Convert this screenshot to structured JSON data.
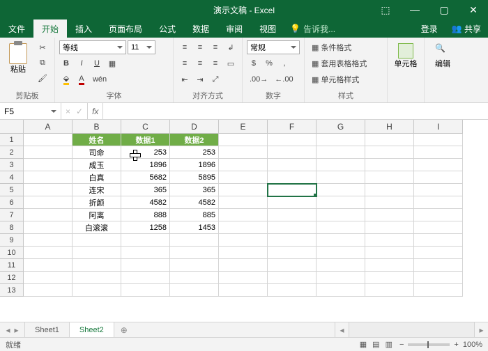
{
  "app": {
    "title": "演示文稿 - Excel"
  },
  "window_icons": {
    "popout": "⬚",
    "min": "—",
    "max": "▢",
    "close": "✕"
  },
  "tabs": {
    "file": "文件",
    "home": "开始",
    "insert": "插入",
    "layout": "页面布局",
    "formula": "公式",
    "data": "数据",
    "review": "审阅",
    "view": "视图",
    "tell": "告诉我...",
    "signin": "登录",
    "share": "共享"
  },
  "ribbon": {
    "clipboard": {
      "label": "剪贴板",
      "paste": "粘贴"
    },
    "font": {
      "label": "字体",
      "name": "等线",
      "size": "11",
      "bold": "B",
      "italic": "I",
      "underline": "U"
    },
    "align": {
      "label": "对齐方式"
    },
    "number": {
      "label": "数字",
      "format": "常规"
    },
    "styles": {
      "label": "样式",
      "cond": "条件格式",
      "table": "套用表格格式",
      "cell": "单元格样式"
    },
    "cells": {
      "label": "单元格"
    },
    "editing": {
      "label": "编辑"
    }
  },
  "namebox": "F5",
  "formula": "",
  "cols": [
    "A",
    "B",
    "C",
    "D",
    "E",
    "F",
    "G",
    "H",
    "I"
  ],
  "rows": 13,
  "header_row": [
    "姓名",
    "数据1",
    "数据2"
  ],
  "data_rows": [
    [
      "司命",
      "253",
      "253"
    ],
    [
      "成玉",
      "1896",
      "1896"
    ],
    [
      "白真",
      "5682",
      "5895"
    ],
    [
      "连宋",
      "365",
      "365"
    ],
    [
      "折颜",
      "4582",
      "4582"
    ],
    [
      "阿离",
      "888",
      "885"
    ],
    [
      "白滚滚",
      "1258",
      "1453"
    ]
  ],
  "selected_cell": {
    "col": 5,
    "row": 4
  },
  "sheets": {
    "s1": "Sheet1",
    "s2": "Sheet2"
  },
  "status": {
    "ready": "就绪",
    "zoom": "100%"
  },
  "colors": {
    "brand": "#0e6636",
    "header_cell": "#70ad47",
    "selection": "#217346"
  }
}
